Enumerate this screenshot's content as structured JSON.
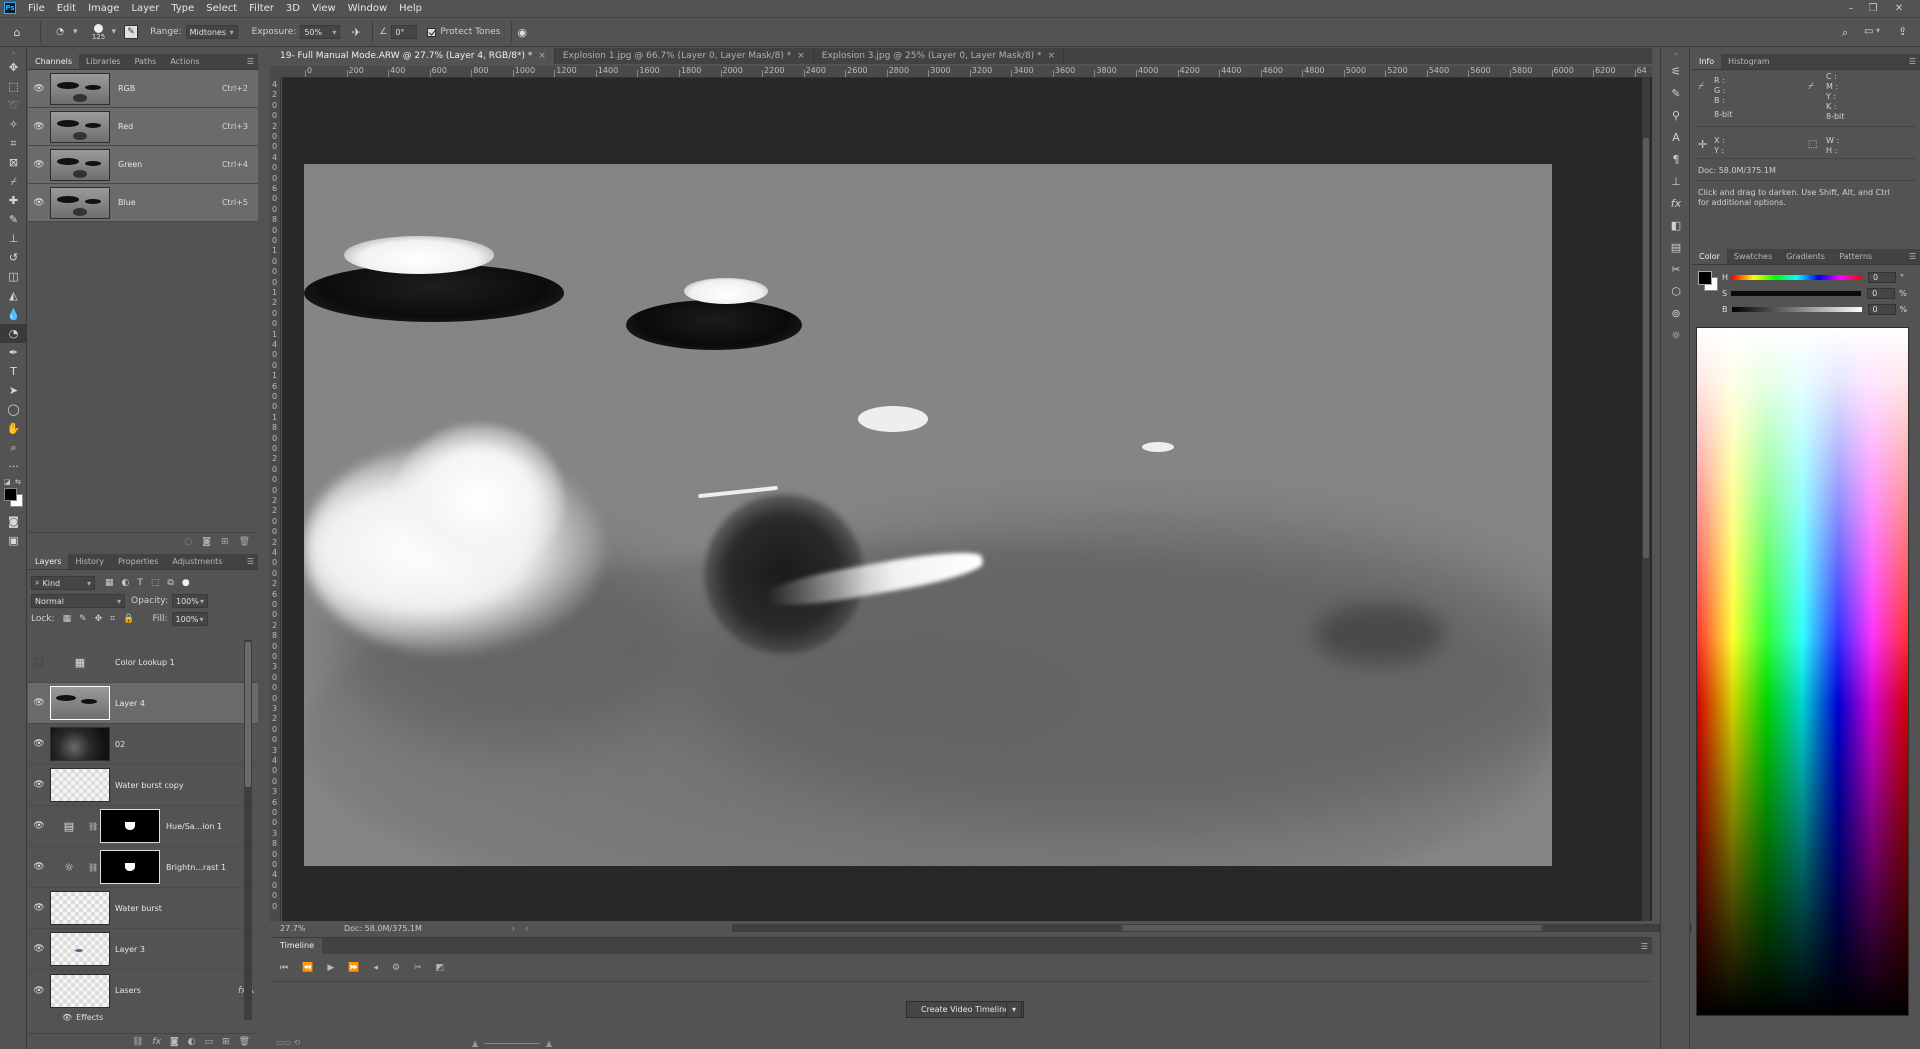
{
  "app": {
    "logo": "Ps",
    "menu": [
      "File",
      "Edit",
      "Image",
      "Layer",
      "Type",
      "Select",
      "Filter",
      "3D",
      "View",
      "Window",
      "Help"
    ]
  },
  "options": {
    "brush_size": "125",
    "range_label": "Range:",
    "range_value": "Midtones",
    "exposure_label": "Exposure:",
    "exposure_value": "50%",
    "angle_value": "0°",
    "protect_tones_label": "Protect Tones",
    "protect_tones_checked": true
  },
  "channels_panel": {
    "tabs": [
      "Channels",
      "Libraries",
      "Paths",
      "Actions"
    ],
    "active_tab": "Channels",
    "rows": [
      {
        "name": "RGB",
        "shortcut": "Ctrl+2"
      },
      {
        "name": "Red",
        "shortcut": "Ctrl+3"
      },
      {
        "name": "Green",
        "shortcut": "Ctrl+4"
      },
      {
        "name": "Blue",
        "shortcut": "Ctrl+5"
      }
    ]
  },
  "layers_panel": {
    "tabs": [
      "Layers",
      "History",
      "Properties",
      "Adjustments"
    ],
    "active_tab": "Layers",
    "filter_kind": "Kind",
    "blend_mode": "Normal",
    "opacity_label": "Opacity:",
    "opacity_value": "100%",
    "lock_label": "Lock:",
    "fill_label": "Fill:",
    "fill_value": "100%",
    "layers": [
      {
        "name": "Color Lookup 1",
        "kind": "adjustment",
        "visible": false
      },
      {
        "name": "Layer 4",
        "kind": "pixel",
        "visible": true,
        "selected": true
      },
      {
        "name": "02",
        "kind": "pixel",
        "visible": true
      },
      {
        "name": "Water burst copy",
        "kind": "pixel",
        "visible": true
      },
      {
        "name": "Hue/Sa...ion 1",
        "kind": "adjustment-mask",
        "visible": true
      },
      {
        "name": "Brightn...rast 1",
        "kind": "adjustment-mask",
        "visible": true
      },
      {
        "name": "Water burst",
        "kind": "pixel",
        "visible": true
      },
      {
        "name": "Layer 3",
        "kind": "pixel",
        "visible": true
      },
      {
        "name": "Lasers",
        "kind": "pixel",
        "visible": true,
        "has_fx": true
      }
    ],
    "effects_label": "Effects",
    "fx_label": "fx"
  },
  "documents": {
    "tabs": [
      {
        "title": "19- Full Manual Mode.ARW @ 27.7% (Layer 4, RGB/8*) *",
        "active": true
      },
      {
        "title": "Explosion 1.jpg @ 66.7% (Layer 0, Layer Mask/8) *",
        "active": false
      },
      {
        "title": "Explosion 3.jpg @ 25% (Layer 0, Layer Mask/8) *",
        "active": false
      }
    ],
    "close_glyph": "×"
  },
  "rulers": {
    "horizontal": [
      "0",
      "200",
      "400",
      "600",
      "800",
      "1000",
      "1200",
      "1400",
      "1600",
      "1800",
      "2000",
      "2200",
      "2400",
      "2600",
      "2800",
      "3000",
      "3200",
      "3400",
      "3600",
      "3800",
      "4000",
      "4200",
      "4400",
      "4600",
      "4800",
      "5000",
      "5200",
      "5400",
      "5600",
      "5800",
      "6000",
      "6200",
      "64"
    ],
    "vertical": [
      "4",
      "2",
      "0",
      "0",
      "2",
      "0",
      "0",
      "4",
      "0",
      "0",
      "6",
      "0",
      "0",
      "8",
      "0",
      "0",
      "1",
      "0",
      "0",
      "0",
      "1",
      "2",
      "0",
      "0",
      "1",
      "4",
      "0",
      "0",
      "1",
      "6",
      "0",
      "0",
      "1",
      "8",
      "0",
      "0",
      "2",
      "0",
      "0",
      "0",
      "2",
      "2",
      "0",
      "0",
      "2",
      "4",
      "0",
      "0",
      "2",
      "6",
      "0",
      "0",
      "2",
      "8",
      "0",
      "0",
      "3",
      "0",
      "0",
      "0",
      "3",
      "2",
      "0",
      "0",
      "3",
      "4",
      "0",
      "0",
      "3",
      "6",
      "0",
      "0",
      "3",
      "8",
      "0",
      "0",
      "4",
      "0",
      "0",
      "0"
    ]
  },
  "status": {
    "zoom": "27.7%",
    "doc_size": "Doc: 58.0M/375.1M"
  },
  "timeline": {
    "title": "Timeline",
    "create_button": "Create Video Timeline"
  },
  "info_panel": {
    "tabs": [
      "Info",
      "Histogram"
    ],
    "active_tab": "Info",
    "rgb_labels": [
      "R :",
      "G :",
      "B :"
    ],
    "cmyk_labels": [
      "C :",
      "M :",
      "Y :",
      "K :"
    ],
    "bit_depth_left": "8-bit",
    "bit_depth_right": "8-bit",
    "xy_labels": [
      "X :",
      "Y :"
    ],
    "wh_labels": [
      "W :",
      "H :"
    ],
    "doc_size": "Doc: 58.0M/375.1M",
    "hint": "Click and drag to darken.  Use Shift, Alt, and Ctrl for additional options."
  },
  "color_panel": {
    "tabs": [
      "Color",
      "Swatches",
      "Gradients",
      "Patterns"
    ],
    "active_tab": "Color",
    "sliders": [
      {
        "label": "H",
        "value": "0",
        "unit": "°"
      },
      {
        "label": "S",
        "value": "0",
        "unit": "%"
      },
      {
        "label": "B",
        "value": "0",
        "unit": "%"
      }
    ],
    "foreground": "#000000",
    "background": "#ffffff"
  }
}
